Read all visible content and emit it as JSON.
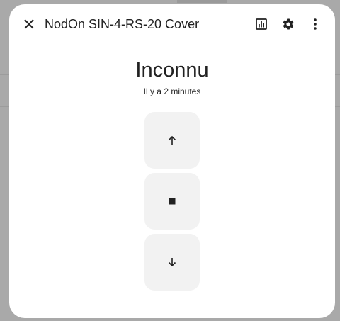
{
  "dialog": {
    "title": "NodOn SIN-4-RS-20 Cover",
    "state": "Inconnu",
    "last_changed": "Il y a 2 minutes"
  },
  "header_icons": {
    "close": "close-icon",
    "history": "chart-box-icon",
    "settings": "gear-icon",
    "more": "more-vertical-icon"
  },
  "controls": [
    {
      "name": "open",
      "icon": "arrow-up-icon"
    },
    {
      "name": "stop",
      "icon": "stop-square-icon"
    },
    {
      "name": "close",
      "icon": "arrow-down-icon"
    }
  ],
  "colors": {
    "dialog_background": "#ffffff",
    "control_background": "#f2f2f2",
    "text": "#212121",
    "backdrop": "#a9a9a9"
  }
}
